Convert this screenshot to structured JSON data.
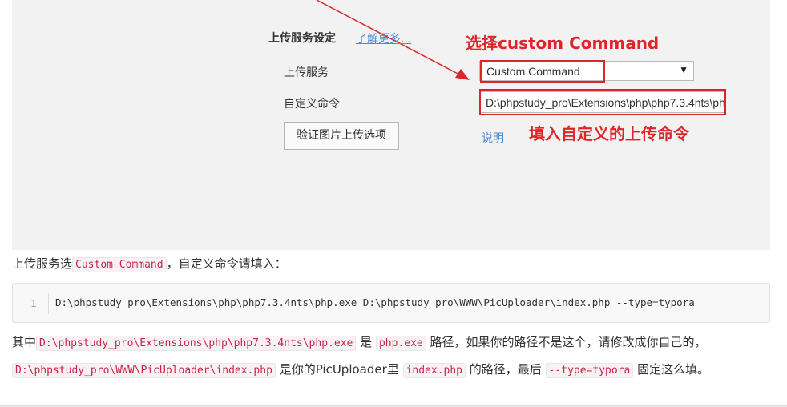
{
  "screenshot": {
    "section_title": "上传服务设定",
    "learn_more_link": "了解更多...",
    "upload_service_label": "上传服务",
    "upload_service_value": "Custom Command",
    "dropdown_arrow": "▼",
    "custom_command_label": "自定义命令",
    "custom_command_value": "D:\\phpstudy_pro\\Extensions\\php\\php7.3.4nts\\php.exe D:\\phpstudy_pro\\WWW\\PicUploader\\index.php --type=typora",
    "verify_button": "验证图片上传选项",
    "help_link": "说明",
    "annotation_select": "选择custom Command",
    "annotation_fill": "填入自定义的上传命令",
    "accent_red": "#e0242a"
  },
  "caption": {
    "prefix": "上传服务选",
    "code": "Custom Command",
    "suffix": "，自定义命令请填入："
  },
  "code_block": {
    "line_number": "1",
    "code": "D:\\phpstudy_pro\\Extensions\\php\\php7.3.4nts\\php.exe D:\\phpstudy_pro\\WWW\\PicUploader\\index.php --type=typora"
  },
  "paragraph": {
    "t1": "其中",
    "c1": "D:\\phpstudy_pro\\Extensions\\php\\php7.3.4nts\\php.exe",
    "t2": "是",
    "c2": "php.exe",
    "t3": "路径，如果你的路径不是这个，请修改成你自己的，",
    "c3": "D:\\phpstudy_pro\\WWW\\PicUploader\\index.php",
    "t4": "是你的PicUploader里",
    "c4": "index.php",
    "t5": "的路径，最后",
    "c5": "--type=typora",
    "t6": "固定这么填。"
  }
}
